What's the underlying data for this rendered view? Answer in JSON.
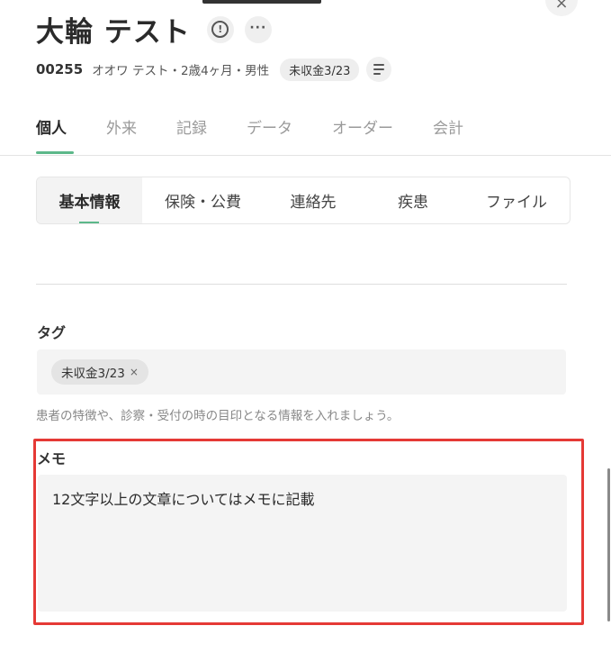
{
  "header": {
    "title": "大輪 テスト",
    "patient_id": "00255",
    "info": "オオワ テスト・2歳4ヶ月・男性",
    "badge": "未収金3/23"
  },
  "icons": {
    "close": "×",
    "alert": "!",
    "more": "···"
  },
  "main_tabs": [
    {
      "label": "個人",
      "active": true
    },
    {
      "label": "外来"
    },
    {
      "label": "記録"
    },
    {
      "label": "データ"
    },
    {
      "label": "オーダー"
    },
    {
      "label": "会計"
    }
  ],
  "sub_tabs": [
    {
      "label": "基本情報",
      "active": true
    },
    {
      "label": "保険・公費"
    },
    {
      "label": "連絡先"
    },
    {
      "label": "疾患"
    },
    {
      "label": "ファイル"
    }
  ],
  "tags": {
    "label": "タグ",
    "chip": "未収金3/23",
    "remove": "×",
    "help": "患者の特徴や、診察・受付の時の目印となる情報を入れましょう。"
  },
  "memo": {
    "label": "メモ",
    "value": "12文字以上の文章についてはメモに記載"
  },
  "colors": {
    "accent": "#5cb88a",
    "highlight": "#e53935"
  }
}
